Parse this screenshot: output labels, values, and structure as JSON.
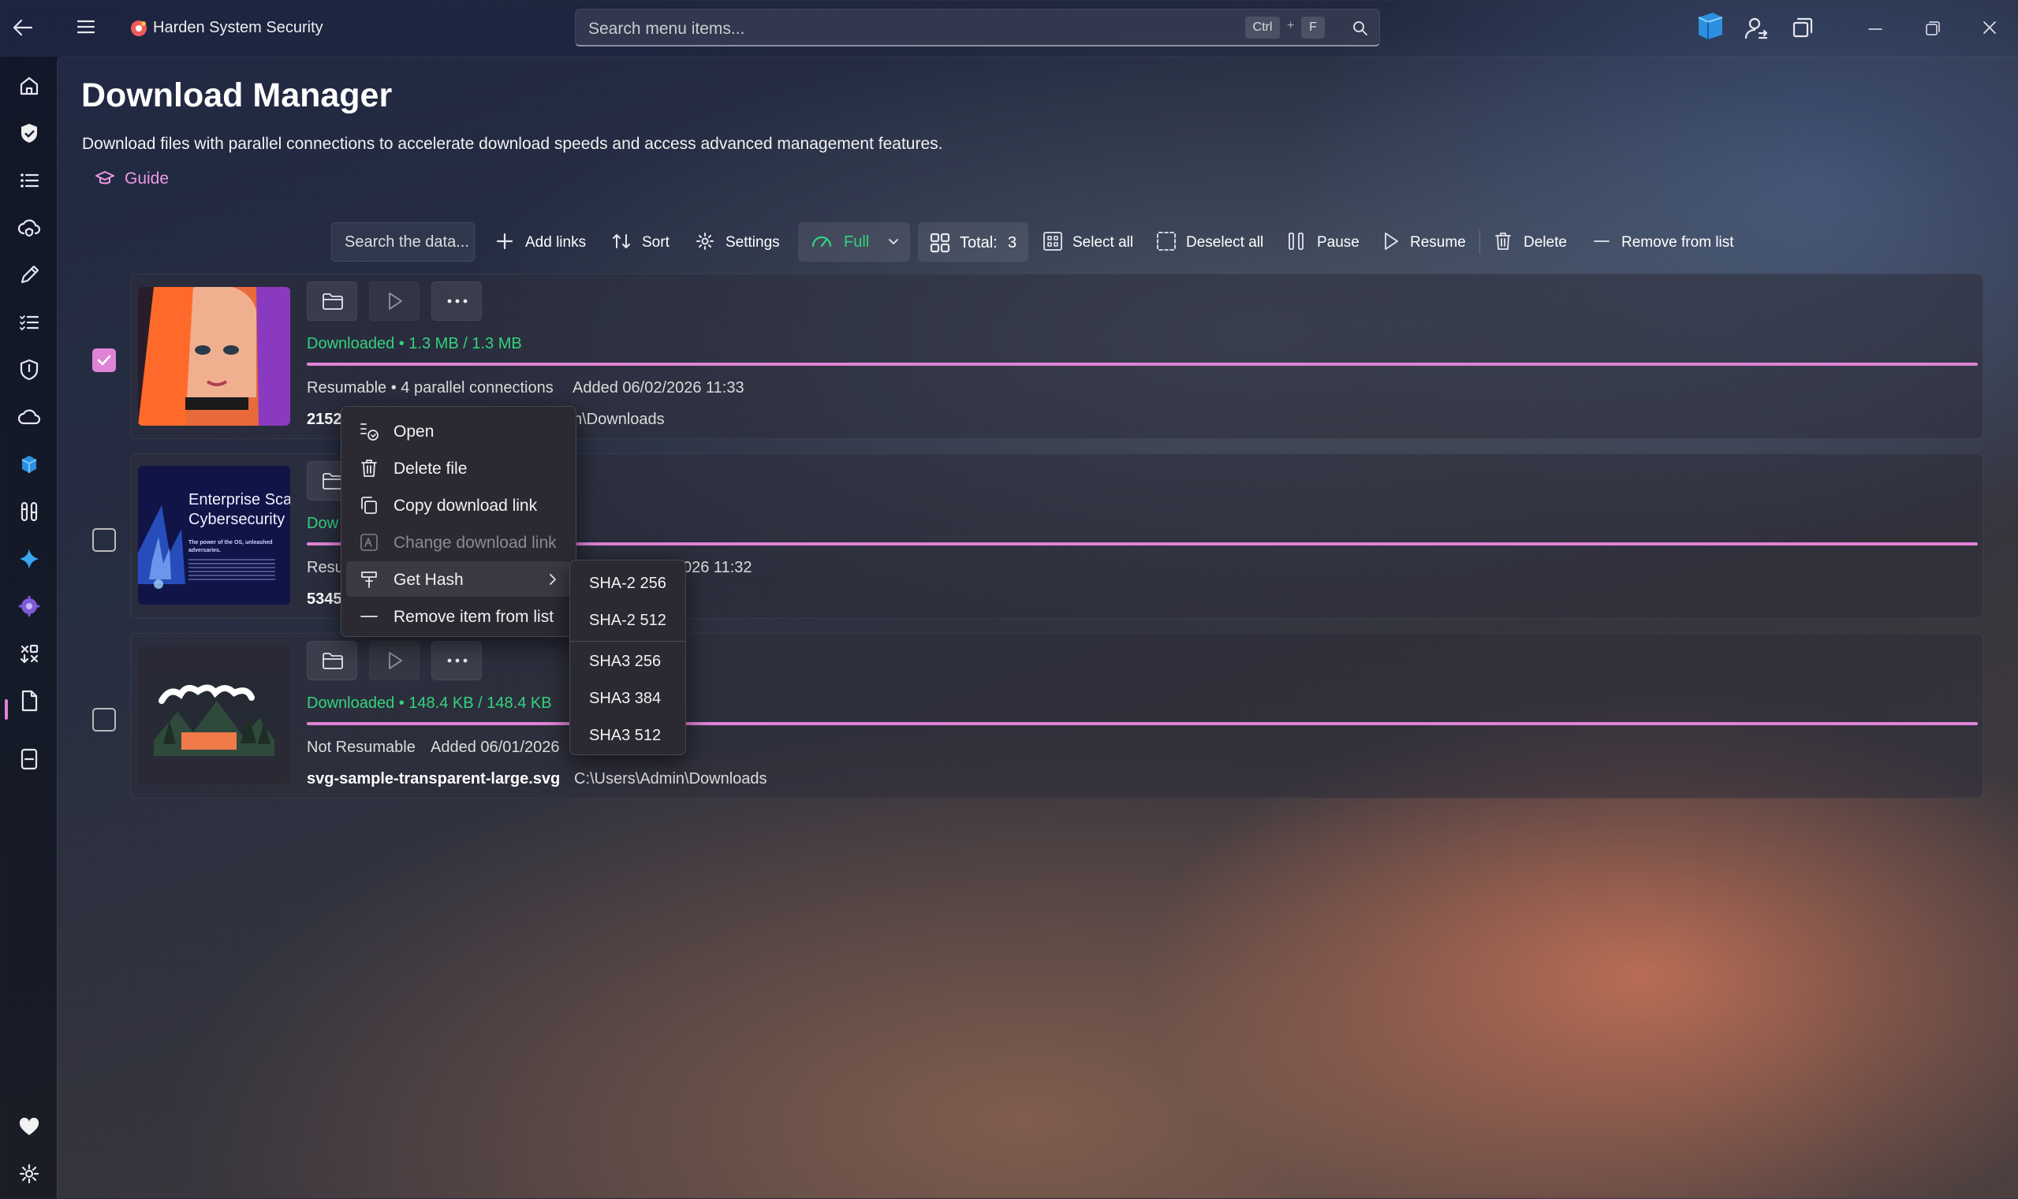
{
  "app": {
    "title": "Harden System Security"
  },
  "search": {
    "placeholder": "Search menu items...",
    "key1": "Ctrl",
    "plus": "+",
    "key2": "F"
  },
  "page": {
    "title": "Download Manager",
    "description": "Download files with parallel connections to accelerate download speeds and access advanced management features.",
    "guide_label": "Guide"
  },
  "toolbar": {
    "search_placeholder": "Search the data...",
    "add_links": "Add links",
    "sort": "Sort",
    "settings": "Settings",
    "mode": "Full",
    "total_label": "Total:",
    "total_value": "3",
    "select_all": "Select all",
    "deselect_all": "Deselect all",
    "pause": "Pause",
    "resume": "Resume",
    "delete": "Delete",
    "remove_from_list": "Remove from list"
  },
  "downloads": [
    {
      "checked": true,
      "status": "Downloaded • 1.3 MB / 1.3 MB",
      "progress": 1.0,
      "meta": "Resumable • 4 parallel connections",
      "added": "Added 06/02/2026 11:33",
      "name_partial": "2152",
      "path_partial": "n\\Downloads"
    },
    {
      "checked": false,
      "status_partial": "Dow",
      "progress": 1.0,
      "meta_partial": "Resu",
      "added_partial": "026 11:32",
      "name_partial": "5345",
      "thumb_title_1": "Enterprise Sca",
      "thumb_title_2": "Cybersecurity",
      "thumb_body_1": "The power of the OS, unleashed",
      "thumb_body_2": "adversaries."
    },
    {
      "checked": false,
      "status": "Downloaded • 148.4 KB / 148.4 KB",
      "progress": 1.0,
      "meta": "Not Resumable",
      "added": "Added 06/01/2026",
      "name": "svg-sample-transparent-large.svg",
      "path": "C:\\Users\\Admin\\Downloads"
    }
  ],
  "context_menu": {
    "items": [
      {
        "label": "Open",
        "icon": "open-icon"
      },
      {
        "label": "Delete file",
        "icon": "trash-icon"
      },
      {
        "label": "Copy download link",
        "icon": "copy-icon"
      },
      {
        "label": "Change download link",
        "icon": "edit-link-icon",
        "disabled": true
      },
      {
        "label": "Get Hash",
        "icon": "hash-icon",
        "submenu": true
      },
      {
        "label": "Remove item from list",
        "icon": "minus-icon"
      }
    ],
    "hash_submenu": [
      "SHA-2 256",
      "SHA-2 512",
      "SHA3 256",
      "SHA3 384",
      "SHA3 512"
    ]
  },
  "colors": {
    "accent": "#e083d6",
    "success": "#32d37e"
  }
}
